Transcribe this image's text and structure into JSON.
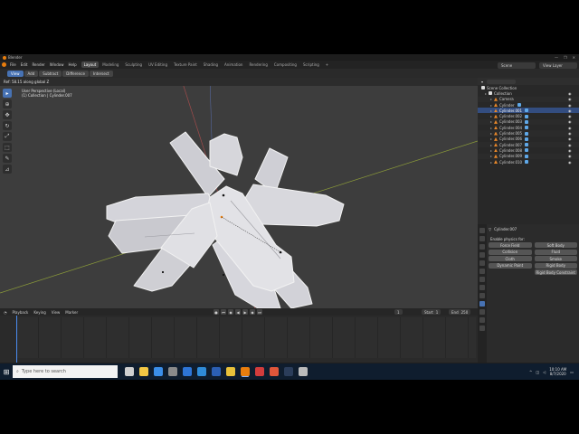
{
  "window": {
    "title": "Blender",
    "controls": [
      "—",
      "❐",
      "✕"
    ]
  },
  "menubar": {
    "menus": [
      "File",
      "Edit",
      "Render",
      "Window",
      "Help"
    ],
    "workspaces": [
      "Layout",
      "Modeling",
      "Sculpting",
      "UV Editing",
      "Texture Paint",
      "Shading",
      "Animation",
      "Rendering",
      "Compositing",
      "Scripting"
    ],
    "active_workspace": "Layout",
    "add_workspace": "+",
    "scene": "Scene",
    "view_layer": "View Layer"
  },
  "tool_header": {
    "modes": [
      "View",
      "Add",
      "Subtract",
      "Difference",
      "Intersect"
    ],
    "active_mode": "View"
  },
  "viewport": {
    "header_text": "Ref: 58.15 along global Z",
    "view_name": "User Perspective (Local)",
    "collection_info": "(1) Collection | Cylinder.007",
    "colors": {
      "background": "#3d3d3d",
      "object_fill": "#d8d8dc",
      "object_shade": "#a8a8ae",
      "x_axis": "#a14b4b",
      "y_axis": "#8a9a3a",
      "origin": "#e87d0d"
    }
  },
  "toolbar": {
    "tools": [
      "select-icon",
      "cursor-icon",
      "move-icon",
      "rotate-icon",
      "scale-icon",
      "transform-icon",
      "annotate-icon",
      "measure-icon"
    ]
  },
  "outliner": {
    "title": "Scene Collection",
    "rows": [
      {
        "label": "Collection",
        "kind": "collection"
      },
      {
        "label": "Camera",
        "kind": "object"
      },
      {
        "label": "Cylinder",
        "kind": "object"
      },
      {
        "label": "Cylinder.001",
        "kind": "object",
        "selected": true
      },
      {
        "label": "Cylinder.002",
        "kind": "object"
      },
      {
        "label": "Cylinder.003",
        "kind": "object"
      },
      {
        "label": "Cylinder.004",
        "kind": "object"
      },
      {
        "label": "Cylinder.005",
        "kind": "object"
      },
      {
        "label": "Cylinder.006",
        "kind": "object"
      },
      {
        "label": "Cylinder.007",
        "kind": "object"
      },
      {
        "label": "Cylinder.008",
        "kind": "object"
      },
      {
        "label": "Cylinder.009",
        "kind": "object"
      },
      {
        "label": "Cylinder.010",
        "kind": "object"
      }
    ]
  },
  "properties": {
    "object_name": "Cylinder.007",
    "section_title": "Enable physics for:",
    "buttons": [
      "Force Field",
      "Soft Body",
      "Collision",
      "Fluid",
      "Cloth",
      "Smoke",
      "Dynamic Paint",
      "Rigid Body",
      "",
      "Rigid Body Constraint"
    ]
  },
  "timeline": {
    "menus": [
      "Playback",
      "Keying",
      "View",
      "Marker"
    ],
    "current_frame": "1",
    "start_label": "Start",
    "start": "1",
    "end_label": "End",
    "end": "250",
    "colors": {
      "playhead": "#4b8cf0"
    }
  },
  "statusbar": {
    "items": [
      "Confirm",
      "Cancel",
      "X axis",
      "Y axis",
      "Z axis",
      "X plane",
      "Y plane",
      "Z plane",
      "Clear Constraints",
      "Snap Invert",
      "Snap Toggle",
      "Move",
      "Rotate",
      "Resize"
    ],
    "stats": "Collection | Cylinder.007 | Verts:0/84 | Faces:0/72 | Tris:1,728 | Objects:1/14 | Mem: 37.9 MiB | v2.80.74"
  },
  "taskbar": {
    "search_placeholder": "Type here to search",
    "time": "10:10 AM",
    "date": "8/7/2020",
    "apps": [
      {
        "name": "task-view-icon",
        "color": "#cfcfcf"
      },
      {
        "name": "file-explorer-icon",
        "color": "#f2c744"
      },
      {
        "name": "store-icon",
        "color": "#3b8ee8"
      },
      {
        "name": "calculator-icon",
        "color": "#8a8a8a"
      },
      {
        "name": "mail-icon",
        "color": "#2e75d6"
      },
      {
        "name": "edge-icon",
        "color": "#2f8bd8"
      },
      {
        "name": "word-icon",
        "color": "#2b5fb3"
      },
      {
        "name": "chrome-icon",
        "color": "#e8c13a"
      },
      {
        "name": "blender-icon",
        "color": "#e87d0d"
      },
      {
        "name": "camera-icon",
        "color": "#d23c3c"
      },
      {
        "name": "brave-icon",
        "color": "#e0563a"
      },
      {
        "name": "steam-icon",
        "color": "#2b3d5a"
      },
      {
        "name": "settings-icon",
        "color": "#bbbbbb"
      }
    ]
  }
}
